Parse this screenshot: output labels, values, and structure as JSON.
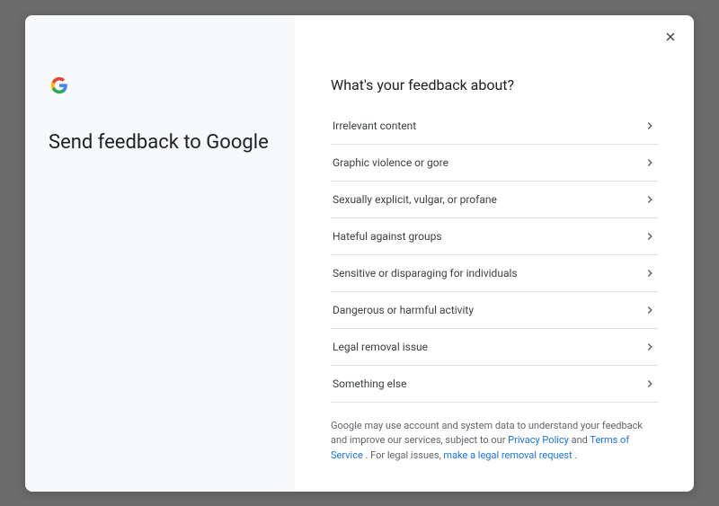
{
  "left": {
    "title": "Send feedback to Google"
  },
  "right": {
    "title": "What's your feedback about?",
    "options": [
      "Irrelevant content",
      "Graphic violence or gore",
      "Sexually explicit, vulgar, or profane",
      "Hateful against groups",
      "Sensitive or disparaging for individuals",
      "Dangerous or harmful activity",
      "Legal removal issue",
      "Something else"
    ]
  },
  "footer": {
    "text1": "Google may use account and system data to understand your feedback and improve our services, subject to our ",
    "privacy": "Privacy Policy",
    "and": " and ",
    "terms": "Terms of Service",
    "period1": " . For legal issues, ",
    "legal": "make a legal removal request",
    "period2": " ."
  }
}
